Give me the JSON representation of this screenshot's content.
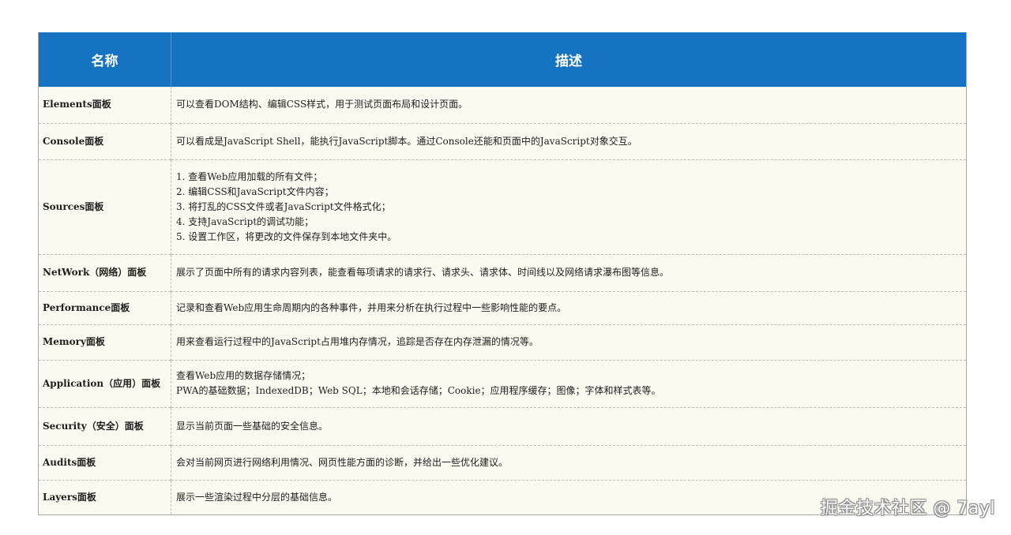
{
  "colors": {
    "header_bg": "#1573c1",
    "header_text": "#ffffff",
    "body_bg": "#fbfaf0",
    "text": "#1e1e1e"
  },
  "table": {
    "headers": {
      "name": "名称",
      "description": "描述"
    },
    "rows": [
      {
        "name": "Elements面板",
        "lines": [
          "可以查看DOM结构、编辑CSS样式，用于测试页面布局和设计页面。"
        ]
      },
      {
        "name": "Console面板",
        "lines": [
          "可以看成是JavaScript Shell，能执行JavaScript脚本。通过Console还能和页面中的JavaScript对象交互。"
        ]
      },
      {
        "name": "Sources面板",
        "lines": [
          "1. 查看Web应用加载的所有文件；",
          "2. 编辑CSS和JavaScript文件内容；",
          "3. 将打乱的CSS文件或者JavaScript文件格式化；",
          "4. 支持JavaScript的调试功能；",
          "5. 设置工作区，将更改的文件保存到本地文件夹中。"
        ]
      },
      {
        "name": "NetWork（网络）面板",
        "lines": [
          "展示了页面中所有的请求内容列表，能查看每项请求的请求行、请求头、请求体、时间线以及网络请求瀑布图等信息。"
        ]
      },
      {
        "name": "Performance面板",
        "lines": [
          "记录和查看Web应用生命周期内的各种事件，并用来分析在执行过程中一些影响性能的要点。"
        ]
      },
      {
        "name": "Memory面板",
        "lines": [
          "用来查看运行过程中的JavaScript占用堆内存情况，追踪是否存在内存泄漏的情况等。"
        ]
      },
      {
        "name": "Application（应用）面板",
        "lines": [
          "查看Web应用的数据存储情况；",
          "PWA的基础数据；IndexedDB；Web SQL；本地和会话存储；Cookie；应用程序缓存；图像；字体和样式表等。"
        ]
      },
      {
        "name": "Security（安全）面板",
        "lines": [
          "显示当前页面一些基础的安全信息。"
        ]
      },
      {
        "name": "Audits面板",
        "lines": [
          "会对当前网页进行网络利用情况、网页性能方面的诊断，并给出一些优化建议。"
        ]
      },
      {
        "name": "Layers面板",
        "lines": [
          "展示一些渲染过程中分层的基础信息。"
        ]
      }
    ]
  },
  "watermark": "掘金技术社区 @ 7ayl"
}
